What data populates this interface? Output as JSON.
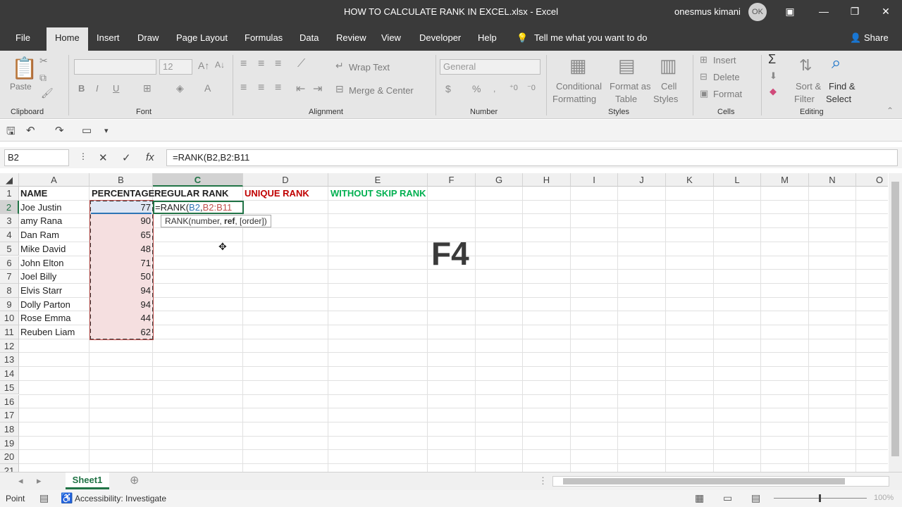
{
  "window": {
    "title": "HOW TO CALCULATE RANK IN EXCEL.xlsx  -  Excel",
    "user": "onesmus kimani",
    "avatar": "OK",
    "min_icon": "—",
    "restore_icon": "❐",
    "close_icon": "✕"
  },
  "menu": {
    "file": "File",
    "home": "Home",
    "insert": "Insert",
    "draw": "Draw",
    "page_layout": "Page Layout",
    "formulas": "Formulas",
    "data": "Data",
    "review": "Review",
    "view": "View",
    "developer": "Developer",
    "help": "Help",
    "tellme": "Tell me what you want to do",
    "share": "Share"
  },
  "ribbon": {
    "paste": "Paste",
    "clipboard": "Clipboard",
    "font_size": "12",
    "font": "Font",
    "bold": "B",
    "italic": "I",
    "underline": "U",
    "wrap_text": "Wrap Text",
    "merge_center": "Merge & Center",
    "alignment": "Alignment",
    "number_format": "General",
    "dollar": "$",
    "percent": "%",
    "number": "Number",
    "conditional_1": "Conditional",
    "conditional_2": "Formatting",
    "format_table_1": "Format as",
    "format_table_2": "Table",
    "cell_styles_1": "Cell",
    "cell_styles_2": "Styles",
    "styles": "Styles",
    "insert": "Insert",
    "delete": "Delete",
    "format": "Format",
    "cells": "Cells",
    "sort_1": "Sort &",
    "sort_2": "Filter",
    "find_1": "Find &",
    "find_2": "Select",
    "editing": "Editing"
  },
  "formula_bar": {
    "name_box": "B2",
    "cancel": "✕",
    "enter": "✓",
    "fx": "fx",
    "formula": "=RANK(B2,B2:B11"
  },
  "columns": [
    "A",
    "B",
    "C",
    "D",
    "E",
    "F",
    "G",
    "H",
    "I",
    "J",
    "K",
    "L",
    "M",
    "N",
    "O"
  ],
  "rows": [
    "1",
    "2",
    "3",
    "4",
    "5",
    "6",
    "7",
    "8",
    "9",
    "10",
    "11",
    "12",
    "13",
    "14",
    "15",
    "16",
    "17",
    "18",
    "19",
    "20",
    "21"
  ],
  "headers": {
    "name": "NAME",
    "percentage": "PERCENTAGE",
    "regular_rank": "REGULAR RANK",
    "unique_rank": "UNIQUE RANK",
    "without_skip": "WITHOUT SKIP RANK"
  },
  "data_rows": [
    {
      "name": "Joe Justin",
      "pct": "77"
    },
    {
      "name": "amy Rana",
      "pct": "90"
    },
    {
      "name": "Dan Ram",
      "pct": "65"
    },
    {
      "name": "Mike David",
      "pct": "48"
    },
    {
      "name": "John Elton",
      "pct": "71"
    },
    {
      "name": "Joel Billy",
      "pct": "50"
    },
    {
      "name": "Elvis Starr",
      "pct": "94"
    },
    {
      "name": "Dolly Parton",
      "pct": "94"
    },
    {
      "name": "Rose Emma",
      "pct": "44"
    },
    {
      "name": "Reuben Liam",
      "pct": "62"
    }
  ],
  "edit_cell": {
    "prefix": "=RANK(",
    "ref1": "B2",
    "comma": ",",
    "ref2": "B2:B11"
  },
  "tooltip": {
    "prefix": "RANK(number, ",
    "bold": "ref",
    "suffix": ", [order])"
  },
  "overlay_key": "F4",
  "sheet": {
    "tab": "Sheet1",
    "add": "⊕"
  },
  "status": {
    "mode": "Point",
    "accessibility": "Accessibility: Investigate",
    "zoom": "100%"
  },
  "colors": {
    "excel_green": "#217346",
    "unique_red": "#c00000",
    "skip_green": "#00b050",
    "ref_blue": "#2e75b6",
    "ref_red": "#c0504d",
    "selection_fill": "#f5dfe0"
  }
}
